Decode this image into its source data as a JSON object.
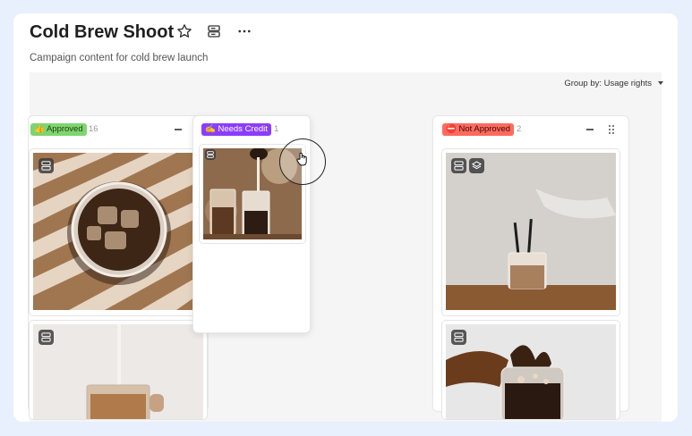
{
  "header": {
    "title": "Cold Brew Shoot",
    "subtitle": "Campaign content for cold brew launch",
    "star_icon": "star-icon",
    "view_icon": "board-view-icon",
    "more_icon": "more-horizontal-icon"
  },
  "toolbar": {
    "group_by_label": "Group by: Usage rights"
  },
  "columns": [
    {
      "label": "👍 Approved",
      "count": "16",
      "color": "#7ed56f",
      "text_color": "#1f3d10"
    },
    {
      "label": "✍️ Needs Credit",
      "count": "1",
      "color": "#8b3dff",
      "text_color": "#ffffff"
    },
    {
      "label": "⛔ Not Approved",
      "count": "2",
      "color": "#ff6a5e",
      "text_color": "#3b0a06"
    }
  ],
  "colors": {
    "background": "#e8effd",
    "board": "#f5f5f5"
  }
}
